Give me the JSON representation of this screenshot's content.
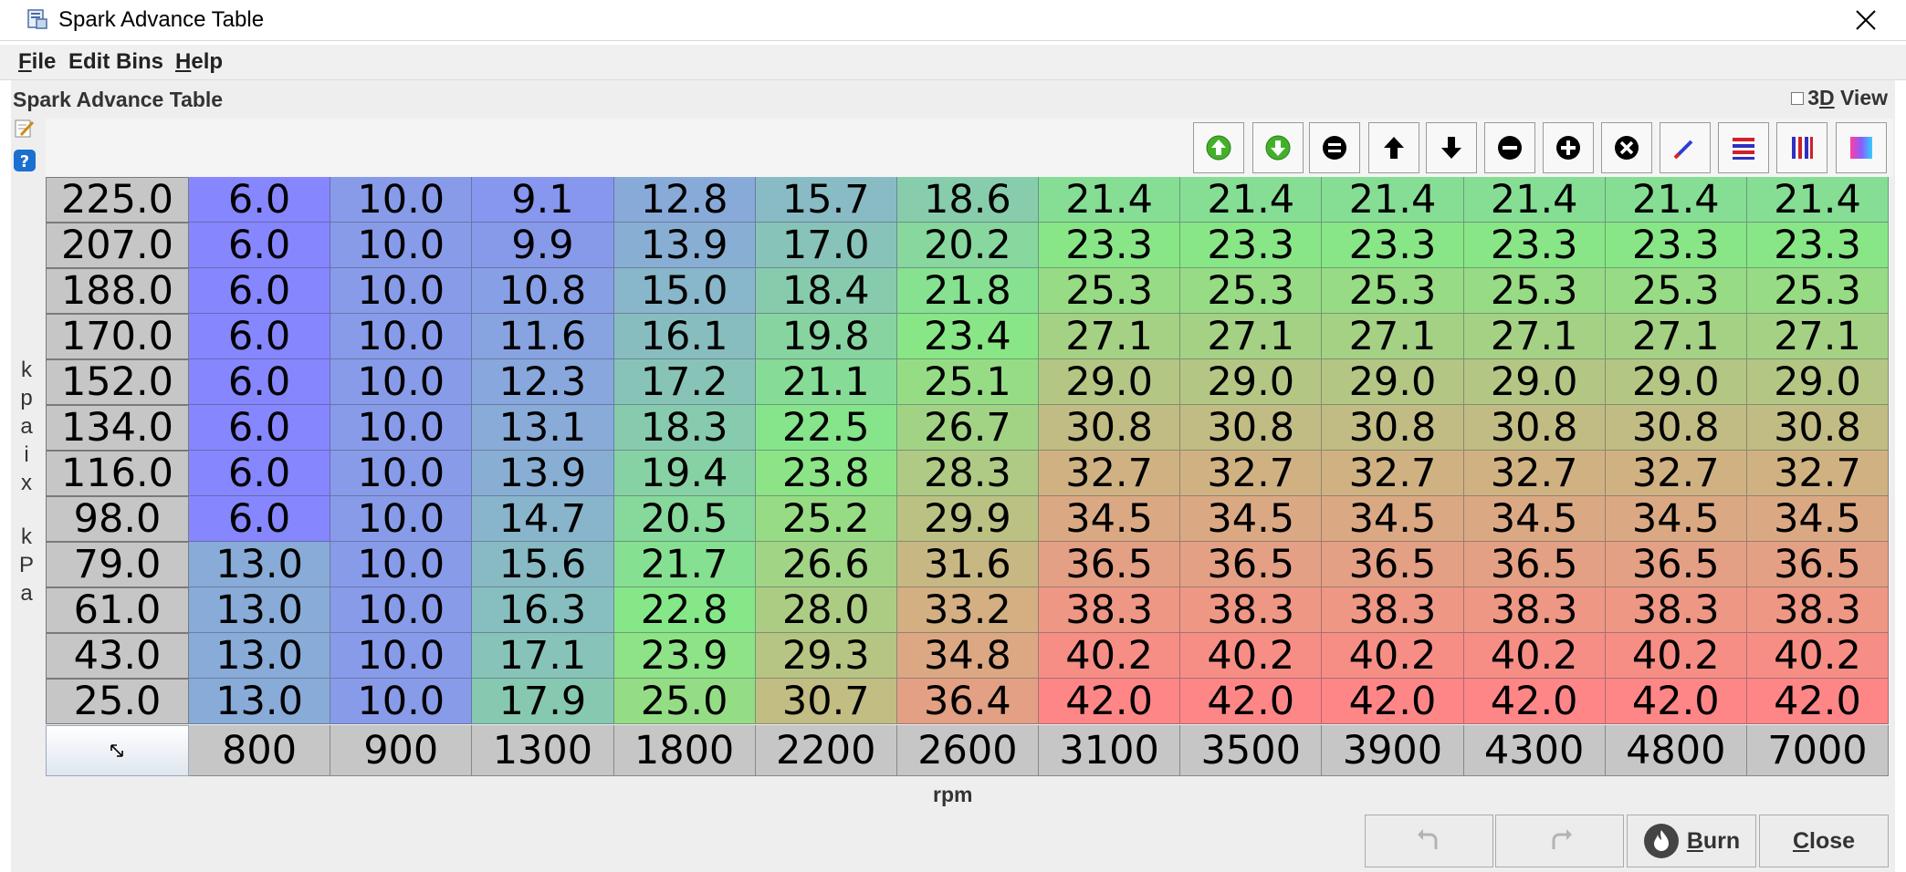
{
  "window": {
    "title": "Spark Advance Table"
  },
  "menu": {
    "file": {
      "mn": "F",
      "rest": "ile"
    },
    "edit_bins": {
      "mn": "",
      "rest": "Edit Bins"
    },
    "help": {
      "mn": "H",
      "rest": "elp"
    }
  },
  "panel": {
    "title": "Spark Advance Table",
    "view3d": {
      "pre": "3",
      "mn": "D",
      "post": " View",
      "checked": false
    }
  },
  "toolbar": [
    {
      "name": "increase-table-button",
      "icon": "up-arrow-green-icon",
      "color": "#43b02a"
    },
    {
      "name": "decrease-table-button",
      "icon": "down-arrow-green-icon",
      "color": "#43b02a"
    },
    {
      "name": "set-equal-button",
      "icon": "equals-icon",
      "color": "#000000"
    },
    {
      "name": "shift-up-button",
      "icon": "arrow-up-icon",
      "color": "#000000"
    },
    {
      "name": "shift-down-button",
      "icon": "arrow-down-icon",
      "color": "#000000"
    },
    {
      "name": "subtract-button",
      "icon": "minus-circle-icon",
      "color": "#000000"
    },
    {
      "name": "add-button",
      "icon": "plus-circle-icon",
      "color": "#000000"
    },
    {
      "name": "multiply-button",
      "icon": "times-circle-icon",
      "color": "#000000"
    },
    {
      "name": "interpolate-button",
      "icon": "pencil-icon",
      "color": "#2b3fd6"
    },
    {
      "name": "horizontal-interpolate-button",
      "icon": "horizontal-lines-icon",
      "color": "#d0202a"
    },
    {
      "name": "vertical-interpolate-button",
      "icon": "vertical-lines-icon",
      "color": "#3030c0"
    },
    {
      "name": "color-gradient-button",
      "icon": "gradient-icon",
      "color": "#8b5cff"
    }
  ],
  "yaxis": {
    "label_top": [
      "k",
      "p",
      "a",
      "i",
      "x"
    ],
    "label_bottom": [
      "k",
      "P",
      "a"
    ]
  },
  "table": {
    "y_values": [
      "225.0",
      "207.0",
      "188.0",
      "170.0",
      "152.0",
      "134.0",
      "116.0",
      "98.0",
      "79.0",
      "61.0",
      "43.0",
      "25.0"
    ],
    "x_values": [
      "800",
      "900",
      "1300",
      "1800",
      "2200",
      "2600",
      "3100",
      "3500",
      "3900",
      "4300",
      "4800",
      "7000"
    ],
    "x_label": "rpm",
    "rows": [
      [
        "6.0",
        "10.0",
        "9.1",
        "12.8",
        "15.7",
        "18.6",
        "21.4",
        "21.4",
        "21.4",
        "21.4",
        "21.4",
        "21.4"
      ],
      [
        "6.0",
        "10.0",
        "9.9",
        "13.9",
        "17.0",
        "20.2",
        "23.3",
        "23.3",
        "23.3",
        "23.3",
        "23.3",
        "23.3"
      ],
      [
        "6.0",
        "10.0",
        "10.8",
        "15.0",
        "18.4",
        "21.8",
        "25.3",
        "25.3",
        "25.3",
        "25.3",
        "25.3",
        "25.3"
      ],
      [
        "6.0",
        "10.0",
        "11.6",
        "16.1",
        "19.8",
        "23.4",
        "27.1",
        "27.1",
        "27.1",
        "27.1",
        "27.1",
        "27.1"
      ],
      [
        "6.0",
        "10.0",
        "12.3",
        "17.2",
        "21.1",
        "25.1",
        "29.0",
        "29.0",
        "29.0",
        "29.0",
        "29.0",
        "29.0"
      ],
      [
        "6.0",
        "10.0",
        "13.1",
        "18.3",
        "22.5",
        "26.7",
        "30.8",
        "30.8",
        "30.8",
        "30.8",
        "30.8",
        "30.8"
      ],
      [
        "6.0",
        "10.0",
        "13.9",
        "19.4",
        "23.8",
        "28.3",
        "32.7",
        "32.7",
        "32.7",
        "32.7",
        "32.7",
        "32.7"
      ],
      [
        "6.0",
        "10.0",
        "14.7",
        "20.5",
        "25.2",
        "29.9",
        "34.5",
        "34.5",
        "34.5",
        "34.5",
        "34.5",
        "34.5"
      ],
      [
        "13.0",
        "10.0",
        "15.6",
        "21.7",
        "26.6",
        "31.6",
        "36.5",
        "36.5",
        "36.5",
        "36.5",
        "36.5",
        "36.5"
      ],
      [
        "13.0",
        "10.0",
        "16.3",
        "22.8",
        "28.0",
        "33.2",
        "38.3",
        "38.3",
        "38.3",
        "38.3",
        "38.3",
        "38.3"
      ],
      [
        "13.0",
        "10.0",
        "17.1",
        "23.9",
        "29.3",
        "34.8",
        "40.2",
        "40.2",
        "40.2",
        "40.2",
        "40.2",
        "40.2"
      ],
      [
        "13.0",
        "10.0",
        "17.9",
        "25.0",
        "30.7",
        "36.4",
        "42.0",
        "42.0",
        "42.0",
        "42.0",
        "42.0",
        "42.0"
      ]
    ]
  },
  "buttons": {
    "undo_icon": "undo-icon",
    "redo_icon": "redo-icon",
    "burn": {
      "mn": "B",
      "rest": "urn"
    },
    "close": {
      "mn": "C",
      "rest": "lose"
    }
  }
}
